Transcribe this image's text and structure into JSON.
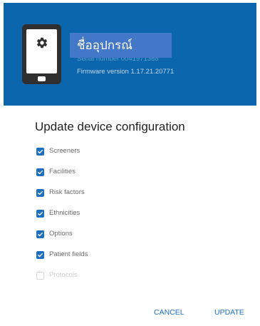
{
  "header": {
    "device_name": "ชื่ออุปกรณ์",
    "serial_text": "Serial number 0041971368",
    "firmware_text": "Firmware version  1.17.21.20771"
  },
  "dialog": {
    "title": "Update device configuration",
    "options": [
      {
        "label": "Screeners",
        "checked": true,
        "enabled": true
      },
      {
        "label": "Facilities",
        "checked": true,
        "enabled": true
      },
      {
        "label": "Risk factors",
        "checked": true,
        "enabled": true
      },
      {
        "label": "Ethnicities",
        "checked": true,
        "enabled": true
      },
      {
        "label": "Options",
        "checked": true,
        "enabled": true
      },
      {
        "label": "Patient fields",
        "checked": true,
        "enabled": true
      },
      {
        "label": "Protocols",
        "checked": false,
        "enabled": false
      }
    ],
    "cancel_label": "CANCEL",
    "update_label": "UPDATE"
  },
  "colors": {
    "header_bg": "#0b66ad",
    "accent": "#1e70bf",
    "name_highlight": "#4278c7"
  },
  "icons": {
    "device": "device-tablet-icon",
    "settings": "gear-icon",
    "check": "checkmark-icon"
  }
}
